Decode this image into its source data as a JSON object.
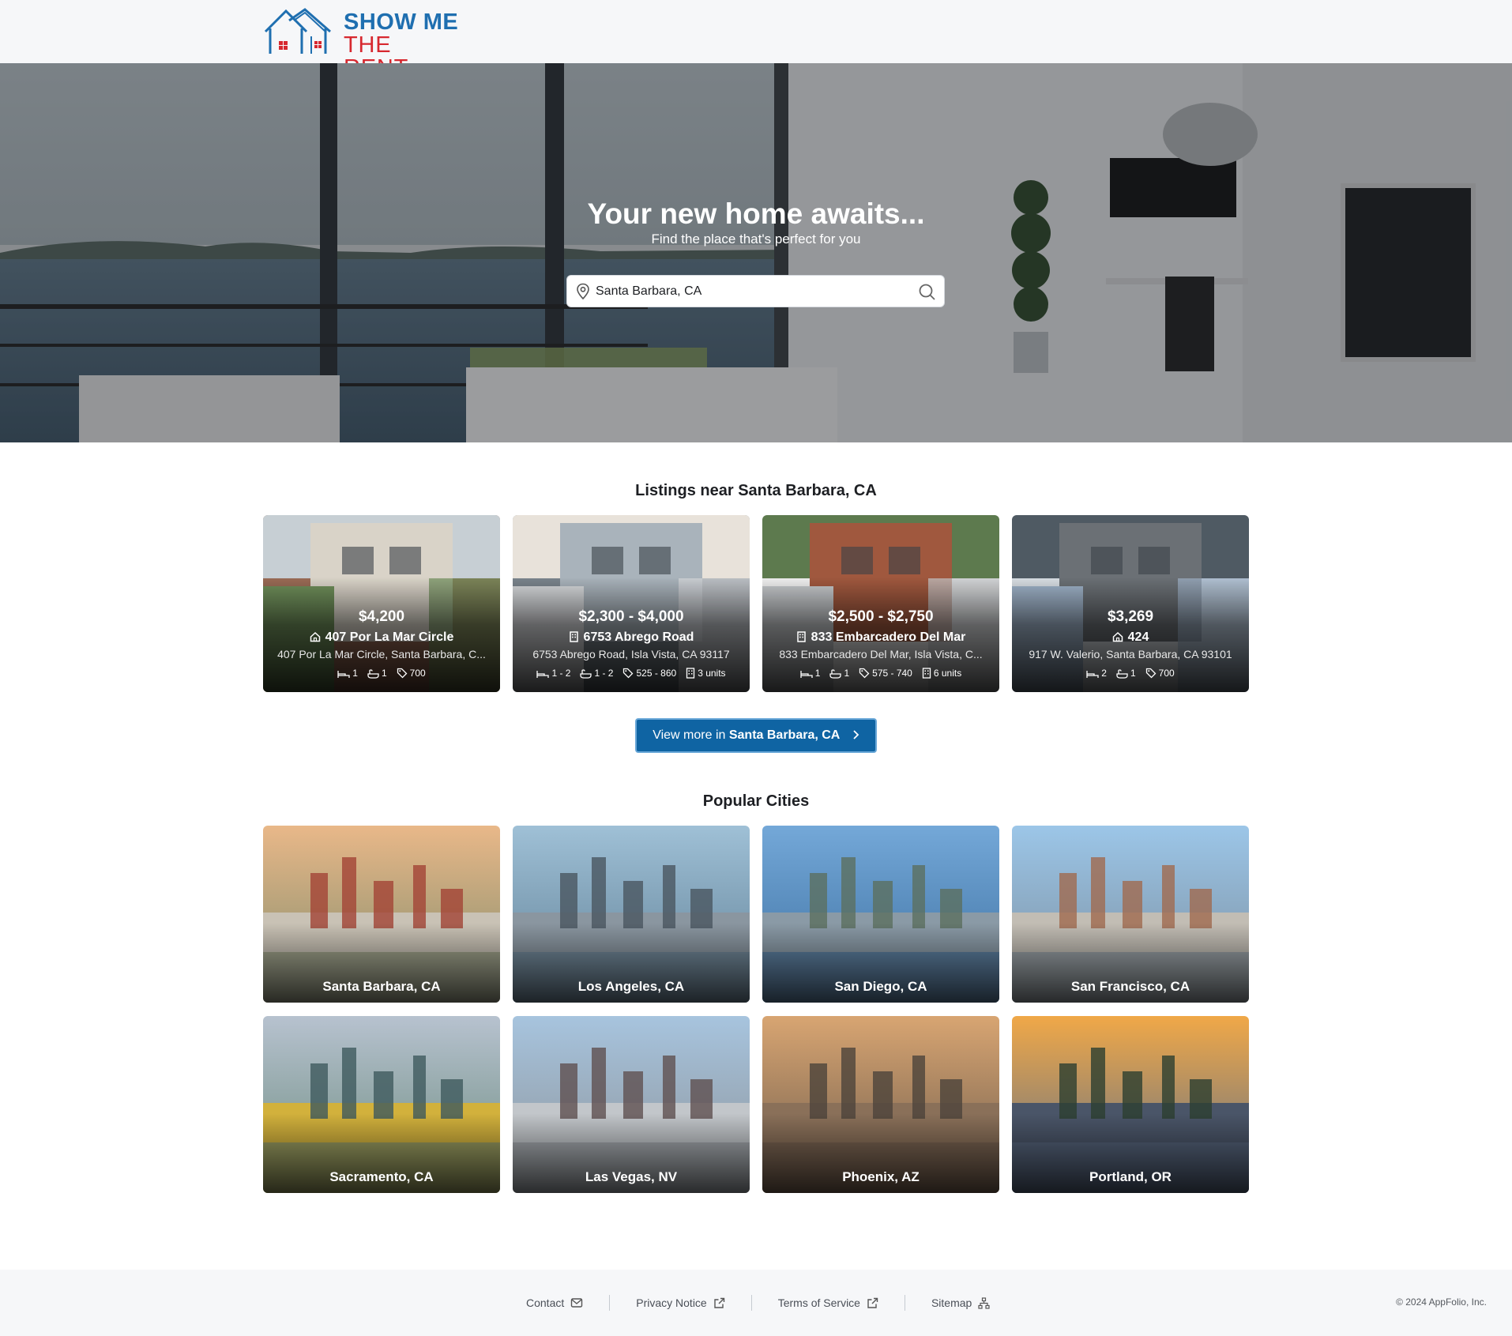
{
  "brand": {
    "line1": "SHOW ME",
    "line2": "THE RENT",
    "colors": {
      "blue": "#1f6fb0",
      "red": "#d7282f"
    },
    "icon": "house-roofs-logo-icon"
  },
  "hero": {
    "title": "Your new home awaits...",
    "subtitle": "Find the place that's perfect for you",
    "search": {
      "value": "Santa Barbara, CA",
      "location_icon": "map-pin-icon",
      "submit_icon": "search-icon"
    }
  },
  "listings": {
    "heading": "Listings near Santa Barbara, CA",
    "items": [
      {
        "price": "$4,200",
        "name": "407 Por La Mar Circle",
        "type_icon": "house-icon",
        "address": "407 Por La Mar Circle, Santa Barbara, C...",
        "beds": "1",
        "baths": "1",
        "sqft": "700",
        "units": ""
      },
      {
        "price": "$2,300 - $4,000",
        "name": "6753 Abrego Road",
        "type_icon": "building-icon",
        "address": "6753 Abrego Road, Isla Vista, CA 93117",
        "beds": "1 - 2",
        "baths": "1 - 2",
        "sqft": "525 - 860",
        "units": "3 units"
      },
      {
        "price": "$2,500 - $2,750",
        "name": "833 Embarcadero Del Mar",
        "type_icon": "building-icon",
        "address": "833 Embarcadero Del Mar, Isla Vista, C...",
        "beds": "1",
        "baths": "1",
        "sqft": "575 - 740",
        "units": "6 units"
      },
      {
        "price": "$3,269",
        "name": "424",
        "type_icon": "house-icon",
        "address": "917 W. Valerio, Santa Barbara, CA 93101",
        "beds": "2",
        "baths": "1",
        "sqft": "700",
        "units": ""
      }
    ],
    "view_more_prefix": "View more in ",
    "view_more_city": "Santa Barbara, CA",
    "view_more_color": "#0f64a3"
  },
  "popular": {
    "heading": "Popular Cities",
    "cities": [
      "Santa Barbara, CA",
      "Los Angeles, CA",
      "San Diego, CA",
      "San Francisco, CA",
      "Sacramento, CA",
      "Las Vegas, NV",
      "Phoenix, AZ",
      "Portland, OR"
    ]
  },
  "footer": {
    "links": [
      {
        "label": "Contact",
        "icon": "mail-icon"
      },
      {
        "label": "Privacy Notice",
        "icon": "external-link-icon"
      },
      {
        "label": "Terms of Service",
        "icon": "external-link-icon"
      },
      {
        "label": "Sitemap",
        "icon": "sitemap-icon"
      }
    ],
    "copyright": "© 2024 AppFolio, Inc."
  }
}
